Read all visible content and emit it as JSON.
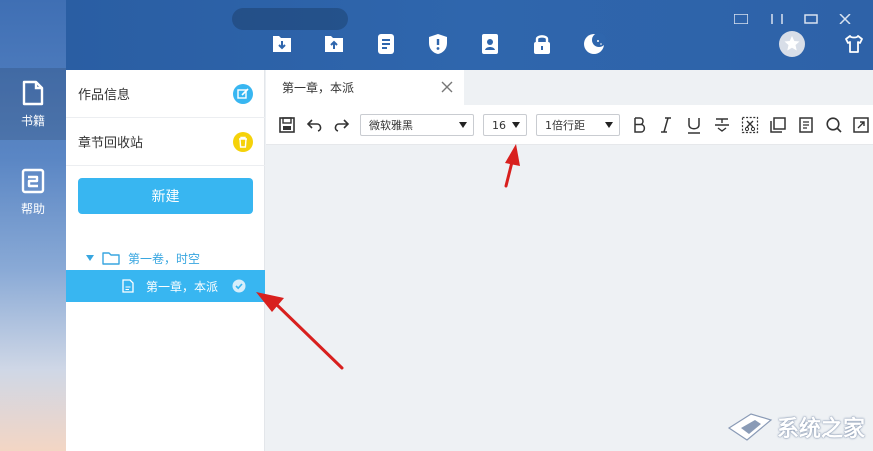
{
  "leftnav": {
    "books_label": "书籍",
    "help_label": "帮助"
  },
  "topbar": {
    "icons": [
      "download-icon",
      "upload-icon",
      "list-icon",
      "shield-icon",
      "contact-icon",
      "lock-icon",
      "night-mode-icon",
      "avatar",
      "shirt-icon"
    ]
  },
  "panel": {
    "info_label": "作品信息",
    "recycle_label": "章节回收站",
    "new_label": "新建",
    "volume_label": "第一卷，时空",
    "chapter_label": "第一章，本派"
  },
  "editor": {
    "tab_label": "第一章，本派",
    "font_name": "微软雅黑",
    "font_size": "16",
    "line_spacing": "1倍行距"
  },
  "watermark": {
    "text": "系统之家"
  },
  "colors": {
    "accent": "#38b6f1",
    "topbar": "#2f66ad",
    "arrow": "#d8201e"
  }
}
